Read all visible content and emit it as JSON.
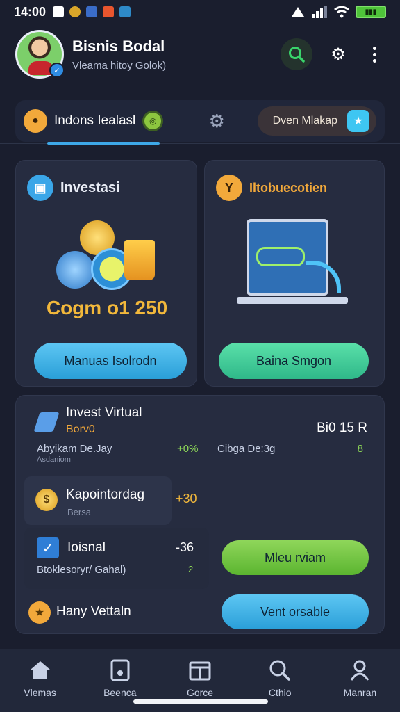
{
  "status_bar": {
    "time": "14:00"
  },
  "header": {
    "title": "Bisnis Bodal",
    "subtitle": "Vleama hitoy Golok)"
  },
  "tabs": {
    "active_label": "Indons Iealasl",
    "pill_label": "Dven Mlakap"
  },
  "cards": {
    "investasi": {
      "title": "Investasi",
      "amount": "Cogm o1 250",
      "button": "Manuas Isolrodn"
    },
    "introduction": {
      "title": "Iltobuecotien",
      "button": "Baina Smgon"
    }
  },
  "invest_panel": {
    "title": "Invest Virtual",
    "subtitle": "Borv0",
    "right_value": "Bi0 15 R",
    "row1_left": "Abyikam De.Jay",
    "row1_left_sub": "Asdaniom",
    "row1_value": "+0%",
    "row1_mid": "Cibga De:3g",
    "row1_right": "8",
    "item1_title": "Kapointordag",
    "item1_sub": "Bersa",
    "item1_value": "+30",
    "item2_title": "Ioisnal",
    "item2_sub": "Btoklesoryr/ Gahal)",
    "item2_value": "-36",
    "item2_value_sub": "2",
    "button_green": "Mleu rviam",
    "footer_title": "Hany Vettaln",
    "button_blue": "Vent orsable"
  },
  "nav": [
    {
      "label": "Vlemas",
      "icon": "home-icon"
    },
    {
      "label": "Beenca",
      "icon": "tablet-icon"
    },
    {
      "label": "Gorce",
      "icon": "calendar-icon"
    },
    {
      "label": "Cthio",
      "icon": "search-icon"
    },
    {
      "label": "Manran",
      "icon": "profile-icon"
    }
  ],
  "colors": {
    "background": "#1a1e2e",
    "card": "#262c40",
    "accent_blue": "#3ea8e8",
    "accent_green": "#2fb889",
    "accent_lime": "#5bb530",
    "accent_gold": "#f2b83b"
  }
}
